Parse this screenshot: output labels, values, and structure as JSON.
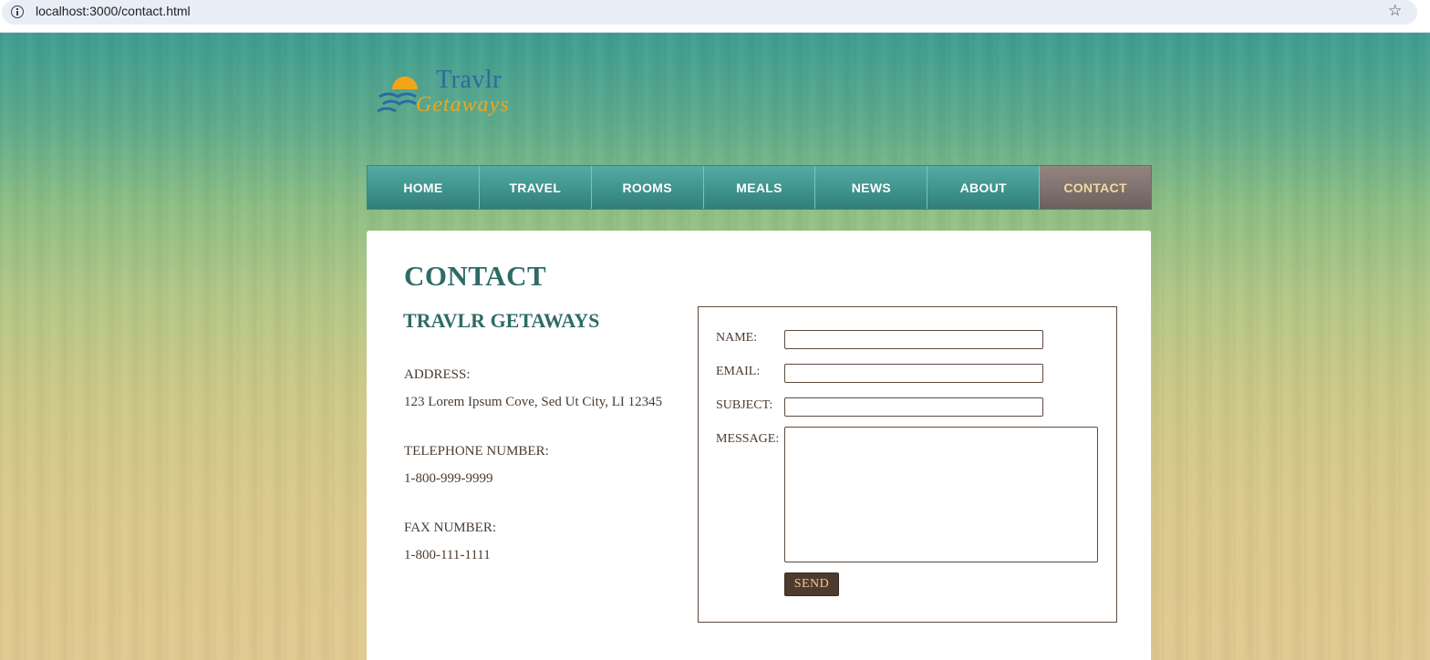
{
  "browser": {
    "url": "localhost:3000/contact.html"
  },
  "logo": {
    "line1": "Travlr",
    "line2": "Getaways"
  },
  "nav": {
    "items": [
      {
        "label": "HOME",
        "active": false
      },
      {
        "label": "TRAVEL",
        "active": false
      },
      {
        "label": "ROOMS",
        "active": false
      },
      {
        "label": "MEALS",
        "active": false
      },
      {
        "label": "NEWS",
        "active": false
      },
      {
        "label": "ABOUT",
        "active": false
      },
      {
        "label": "CONTACT",
        "active": true
      }
    ]
  },
  "content": {
    "title": "CONTACT",
    "company": "TRAVLR GETAWAYS",
    "address_label": "ADDRESS:",
    "address_value": "123 Lorem Ipsum Cove, Sed Ut City, LI 12345",
    "phone_label": "TELEPHONE NUMBER:",
    "phone_value": "1-800-999-9999",
    "fax_label": "FAX NUMBER:",
    "fax_value": "1-800-111-1111"
  },
  "form": {
    "name_label": "NAME:",
    "name_value": "",
    "email_label": "EMAIL:",
    "email_value": "",
    "subject_label": "SUBJECT:",
    "subject_value": "",
    "message_label": "MESSAGE:",
    "message_value": "",
    "send_label": "SEND"
  },
  "colors": {
    "nav_teal": "#3f948d",
    "nav_active": "#7d6f6b",
    "nav_active_text": "#f2d9a0",
    "heading_teal": "#2e6b66",
    "body_brown": "#4a3b30",
    "button_bg": "#4d3b30",
    "button_text": "#f2c98a",
    "logo_blue": "#2b6aa3",
    "logo_orange": "#f2a51a"
  }
}
